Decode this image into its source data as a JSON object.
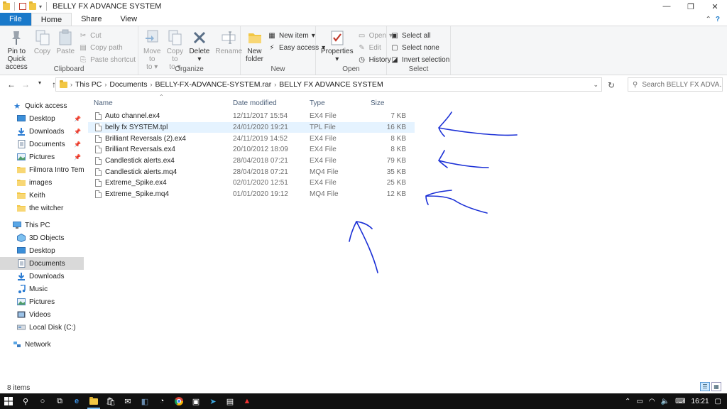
{
  "window": {
    "title": "BELLY FX ADVANCE SYSTEM",
    "controls": [
      "—",
      "❐",
      "✕"
    ]
  },
  "ribbon_tabs": [
    {
      "label": "File"
    },
    {
      "label": "Home"
    },
    {
      "label": "Share"
    },
    {
      "label": "View"
    }
  ],
  "ribbon": {
    "clipboard": {
      "label": "Clipboard",
      "pin": "Pin to Quick access",
      "copy": "Copy",
      "paste": "Paste",
      "cut": "Cut",
      "copy_path": "Copy path",
      "paste_shortcut": "Paste shortcut"
    },
    "organize": {
      "label": "Organize",
      "move_to": "Move to",
      "copy_to": "Copy to",
      "delete": "Delete",
      "rename": "Rename"
    },
    "new": {
      "label": "New",
      "new_folder": "New folder",
      "new_item": "New item",
      "easy_access": "Easy access"
    },
    "open": {
      "label": "Open",
      "properties": "Properties",
      "open": "Open",
      "edit": "Edit",
      "history": "History"
    },
    "select": {
      "label": "Select",
      "select_all": "Select all",
      "select_none": "Select none",
      "invert": "Invert selection"
    }
  },
  "address": {
    "crumbs": [
      "This PC",
      "Documents",
      "BELLY-FX-ADVANCE-SYSTEM.rar",
      "BELLY FX ADVANCE SYSTEM"
    ],
    "search_placeholder": "Search BELLY FX ADVA..."
  },
  "nav": {
    "quick_access": "Quick access",
    "quick_items": [
      {
        "label": "Desktop",
        "icon": "desktop-icon",
        "pinned": true
      },
      {
        "label": "Downloads",
        "icon": "downloads-icon",
        "pinned": true
      },
      {
        "label": "Documents",
        "icon": "documents-icon",
        "pinned": true
      },
      {
        "label": "Pictures",
        "icon": "pictures-icon",
        "pinned": true
      },
      {
        "label": "Filmora Intro Templ",
        "icon": "folder-icon",
        "pinned": false
      },
      {
        "label": "images",
        "icon": "folder-icon",
        "pinned": false
      },
      {
        "label": "Keith",
        "icon": "folder-icon",
        "pinned": false
      },
      {
        "label": "the witcher",
        "icon": "folder-icon",
        "pinned": false
      }
    ],
    "this_pc": "This PC",
    "pc_items": [
      {
        "label": "3D Objects",
        "icon": "3d-objects-icon"
      },
      {
        "label": "Desktop",
        "icon": "desktop-icon"
      },
      {
        "label": "Documents",
        "icon": "documents-icon"
      },
      {
        "label": "Downloads",
        "icon": "downloads-icon"
      },
      {
        "label": "Music",
        "icon": "music-icon"
      },
      {
        "label": "Pictures",
        "icon": "pictures-icon"
      },
      {
        "label": "Videos",
        "icon": "videos-icon"
      },
      {
        "label": "Local Disk (C:)",
        "icon": "drive-icon"
      }
    ],
    "network": "Network"
  },
  "columns": {
    "name": "Name",
    "date": "Date modified",
    "type": "Type",
    "size": "Size"
  },
  "files": [
    {
      "name": "Auto channel.ex4",
      "date": "12/11/2017 15:54",
      "type": "EX4 File",
      "size": "7 KB"
    },
    {
      "name": "belly fx SYSTEM.tpl",
      "date": "24/01/2020 19:21",
      "type": "TPL File",
      "size": "16 KB"
    },
    {
      "name": "Brilliant Reversals (2).ex4",
      "date": "24/11/2019 14:52",
      "type": "EX4 File",
      "size": "8 KB"
    },
    {
      "name": "Brilliant Reversals.ex4",
      "date": "20/10/2012 18:09",
      "type": "EX4 File",
      "size": "8 KB"
    },
    {
      "name": "Candlestick alerts.ex4",
      "date": "28/04/2018 07:21",
      "type": "EX4 File",
      "size": "79 KB"
    },
    {
      "name": "Candlestick alerts.mq4",
      "date": "28/04/2018 07:21",
      "type": "MQ4 File",
      "size": "35 KB"
    },
    {
      "name": "Extreme_Spike.ex4",
      "date": "02/01/2020 12:51",
      "type": "EX4 File",
      "size": "25 KB"
    },
    {
      "name": "Extreme_Spike.mq4",
      "date": "01/01/2020 19:12",
      "type": "MQ4 File",
      "size": "12 KB"
    }
  ],
  "status": {
    "count": "8 items"
  },
  "taskbar": {
    "time": "16:21"
  },
  "colors": {
    "accent": "#1979ca",
    "ink": "#1a2fd6"
  }
}
